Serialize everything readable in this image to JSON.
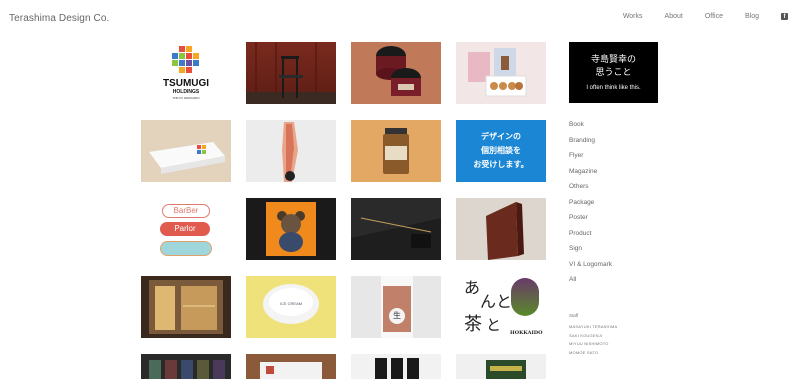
{
  "header": {
    "brand": "Terashima Design Co.",
    "nav": [
      "Works",
      "About",
      "Office",
      "Blog"
    ],
    "facebook_icon": "facebook-icon"
  },
  "tiles": {
    "tsumugi_name": "TSUMUGI",
    "tsumugi_sub": "HOLDINGS",
    "tsumugi_place": "TOKYO HOKKAIDO",
    "consult": [
      "デザインの",
      "個別相談を",
      "お受けします。"
    ],
    "barber": [
      "BarBer",
      "Parlor"
    ],
    "ant_kana": [
      "あ",
      "ん",
      "と"
    ],
    "ant_kanji": "茶",
    "ant_ke": "と",
    "ant_place": "HOKKAIDO",
    "jar_seal": "生",
    "cup_label": "ICE CREAM"
  },
  "sidebar": {
    "feature": {
      "jp_line1": "寺島賢幸の",
      "jp_line2": "思うこと",
      "en": "I often think like this."
    },
    "categories": [
      "Book",
      "Branding",
      "Flyer",
      "Magazine",
      "Others",
      "Package",
      "Poster",
      "Product",
      "Sign",
      "VI & Logomark",
      "All"
    ],
    "staff_heading": "Staff",
    "staff": [
      "MASAYUKI TERASHIMA",
      "SAKI KOUGENJI",
      "MIYUU NISHIMOTO",
      "MOMOE SATO"
    ]
  }
}
